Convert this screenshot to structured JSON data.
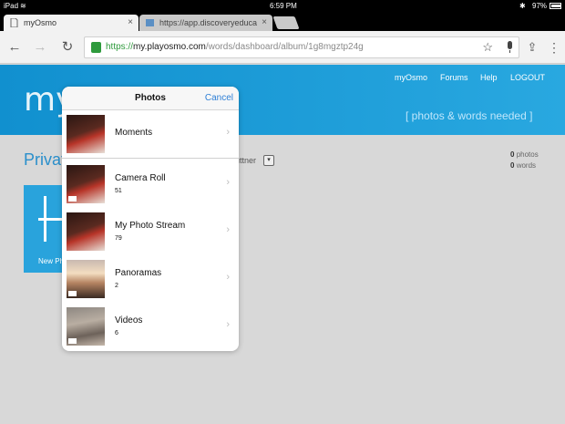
{
  "status": {
    "device": "iPad",
    "time": "6:59 PM",
    "battery": "97%"
  },
  "tabs": [
    {
      "title": "myOsmo",
      "close": "×",
      "active": true
    },
    {
      "title": "https://app.discoveryeduca",
      "close": "×",
      "active": false
    }
  ],
  "toolbar": {
    "url_scheme": "https://",
    "url_host": "my.playosmo.com",
    "url_path": "/words/dashboard/album/1g8mgztp24g",
    "back_glyph": "←",
    "forward_glyph": "→",
    "reload_glyph": "↻",
    "star_glyph": "☆",
    "mic_glyph": "🎤",
    "share_glyph": "⇪",
    "menu_glyph": "⋮"
  },
  "header": {
    "brand": "my",
    "nav": [
      "myOsmo",
      "Forums",
      "Help",
      "LOGOUT"
    ],
    "tagline": "[ photos & words needed ]"
  },
  "page": {
    "section_title": "Privat",
    "owner_fragment": "uttner",
    "owner_dropdown_glyph": "▾",
    "stats": {
      "photos_count": "0",
      "photos_label": "photos",
      "words_count": "0",
      "words_label": "words"
    },
    "new_card_label": "New Ph"
  },
  "popover": {
    "title": "Photos",
    "cancel_label": "Cancel",
    "chevron": "›",
    "albums": [
      {
        "name": "Moments",
        "count": ""
      },
      {
        "name": "Camera Roll",
        "count": "51"
      },
      {
        "name": "My Photo Stream",
        "count": "79"
      },
      {
        "name": "Panoramas",
        "count": "2"
      },
      {
        "name": "Videos",
        "count": "6"
      }
    ]
  },
  "colors": {
    "brand_blue": "#1190cf",
    "accent_link": "#2f7fd6",
    "secure_green": "#2e9a3c"
  }
}
